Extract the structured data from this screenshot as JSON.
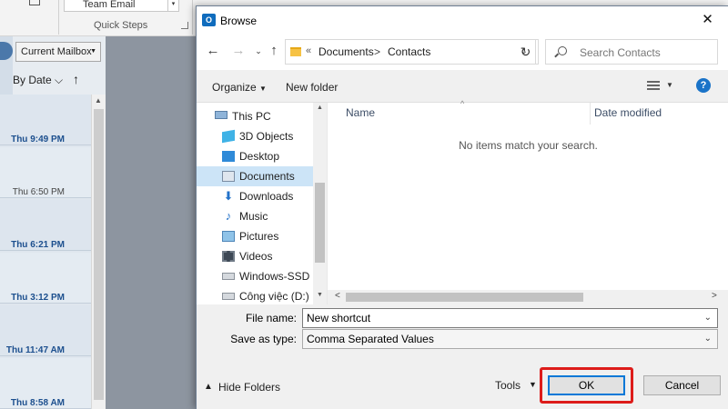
{
  "background": {
    "ribbon": {
      "team_email": "Team Email",
      "quick_steps": "Quick Steps"
    },
    "scope": "Current Mailbox",
    "sort": "By Date",
    "mail_times": [
      {
        "text": "Thu 9:49 PM",
        "unread": true
      },
      {
        "text": "Thu 6:50 PM",
        "unread": false
      },
      {
        "text": "Thu 6:21 PM",
        "unread": true
      },
      {
        "text": "Thu 3:12 PM",
        "unread": true
      },
      {
        "text": "Thu 11:47 AM",
        "unread": true
      },
      {
        "text": "Thu 8:58 AM",
        "unread": true
      }
    ]
  },
  "dialog": {
    "title": "Browse",
    "app_icon_letter": "O",
    "close": "✕",
    "address": {
      "segments": [
        "Documents",
        "Contacts"
      ],
      "overflow": "«"
    },
    "search_placeholder": "Search Contacts",
    "commands": {
      "organize": "Organize",
      "new_folder": "New folder",
      "help": "?"
    },
    "nav_items": [
      {
        "label": "This PC",
        "icon": "pc-icon",
        "selected": false
      },
      {
        "label": "3D Objects",
        "icon": "3d-objects-icon",
        "selected": false
      },
      {
        "label": "Desktop",
        "icon": "desktop-icon",
        "selected": false
      },
      {
        "label": "Documents",
        "icon": "documents-icon",
        "selected": true
      },
      {
        "label": "Downloads",
        "icon": "downloads-icon",
        "selected": false
      },
      {
        "label": "Music",
        "icon": "music-icon",
        "selected": false
      },
      {
        "label": "Pictures",
        "icon": "pictures-icon",
        "selected": false
      },
      {
        "label": "Videos",
        "icon": "videos-icon",
        "selected": false
      },
      {
        "label": "Windows-SSD (C",
        "icon": "drive-icon",
        "selected": false
      },
      {
        "label": "Công việc (D:)",
        "icon": "drive-icon",
        "selected": false
      }
    ],
    "columns": {
      "name": "Name",
      "date_modified": "Date modified"
    },
    "empty_message": "No items match your search.",
    "file_name": {
      "label": "File name:",
      "value": "New shortcut"
    },
    "save_as_type": {
      "label": "Save as type:",
      "value": "Comma Separated Values"
    },
    "hide_folders": "Hide Folders",
    "tools": "Tools",
    "ok": "OK",
    "cancel": "Cancel",
    "colors": {
      "highlight": "#dd1c1a",
      "accent": "#0078d7",
      "selection": "#cce4f7"
    }
  }
}
